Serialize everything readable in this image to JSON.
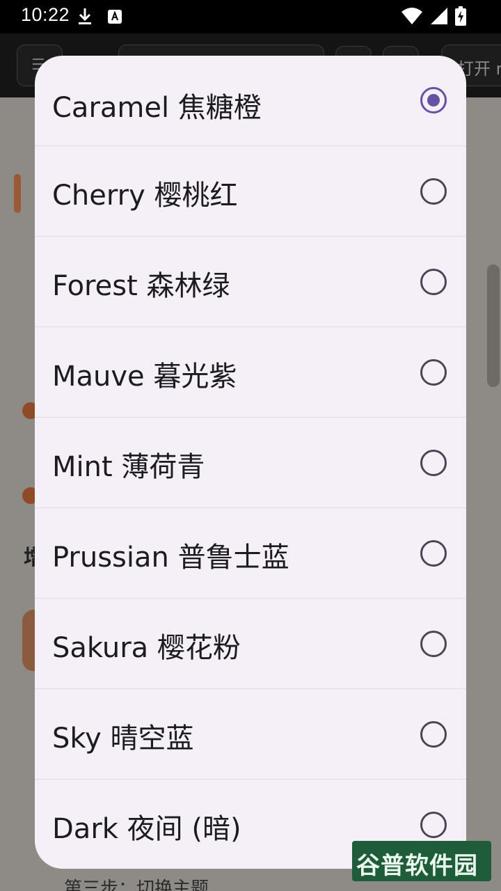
{
  "status_bar": {
    "time": "10:22",
    "icons": [
      "download-icon",
      "keyboard-a-icon",
      "wifi-icon",
      "cell-signal-icon",
      "battery-charging-icon"
    ]
  },
  "background_app": {
    "open_button_label": "打开 r",
    "heading_char": "增",
    "bottom_text": "第三步：切换主题"
  },
  "theme_dialog": {
    "selected_index": 0,
    "options": [
      {
        "label": "Caramel 焦糖橙",
        "checked": true
      },
      {
        "label": "Cherry 樱桃红",
        "checked": false
      },
      {
        "label": "Forest 森林绿",
        "checked": false
      },
      {
        "label": "Mauve 暮光紫",
        "checked": false
      },
      {
        "label": "Mint 薄荷青",
        "checked": false
      },
      {
        "label": "Prussian 普鲁士蓝",
        "checked": false
      },
      {
        "label": "Sakura 樱花粉",
        "checked": false
      },
      {
        "label": "Sky 晴空蓝",
        "checked": false
      },
      {
        "label": "Dark 夜间 (暗)",
        "checked": false
      }
    ]
  },
  "watermark": {
    "text": "谷普软件园"
  },
  "colors": {
    "dialog_bg": "#f5eff7",
    "radio_selected": "#6750a4",
    "radio_unselected": "#4a4458",
    "scrim": "#8e8a85"
  }
}
